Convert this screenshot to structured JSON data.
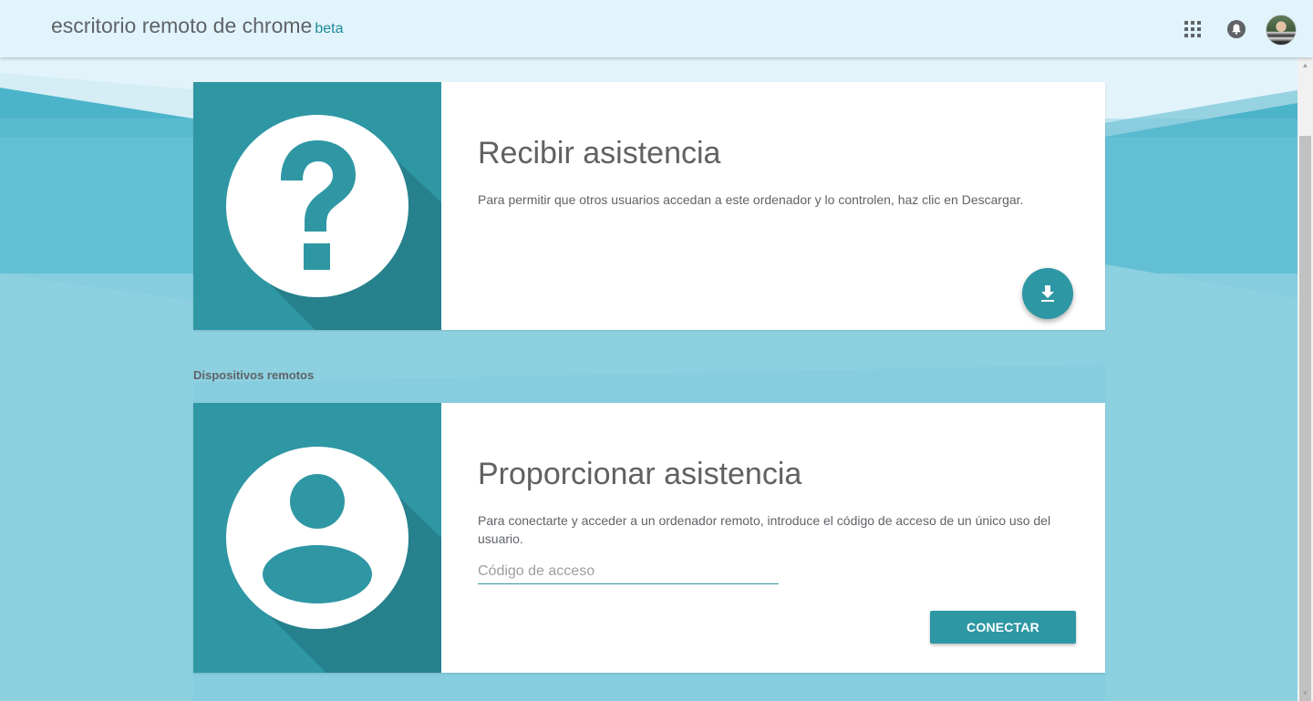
{
  "header": {
    "app_title": "escritorio remoto de chrome",
    "beta_label": "beta",
    "icons": [
      "apps-grid-icon",
      "notifications-bell-icon",
      "account-avatar"
    ]
  },
  "support_card": {
    "title": "Recibir asistencia",
    "description": "Para permitir que otros usuarios accedan a este ordenador y lo controlen, haz clic en Descargar.",
    "icon": "question-mark-icon",
    "action_icon": "download-icon"
  },
  "remote_devices": {
    "section_label": "Dispositivos remotos"
  },
  "assist_card": {
    "title": "Proporcionar asistencia",
    "description": "Para conectarte y acceder a un ordenador remoto, introduce el código de acceso de un único uso del usuario.",
    "icon": "user-person-icon",
    "access_code": {
      "placeholder": "Código de acceso",
      "value": ""
    },
    "connect_label": "CONECTAR"
  },
  "colors": {
    "accent": "#2e97a4",
    "accent_dark": "#26818c",
    "header_bg": "#e1f4fb",
    "page_bg": "#8fd2e2"
  }
}
